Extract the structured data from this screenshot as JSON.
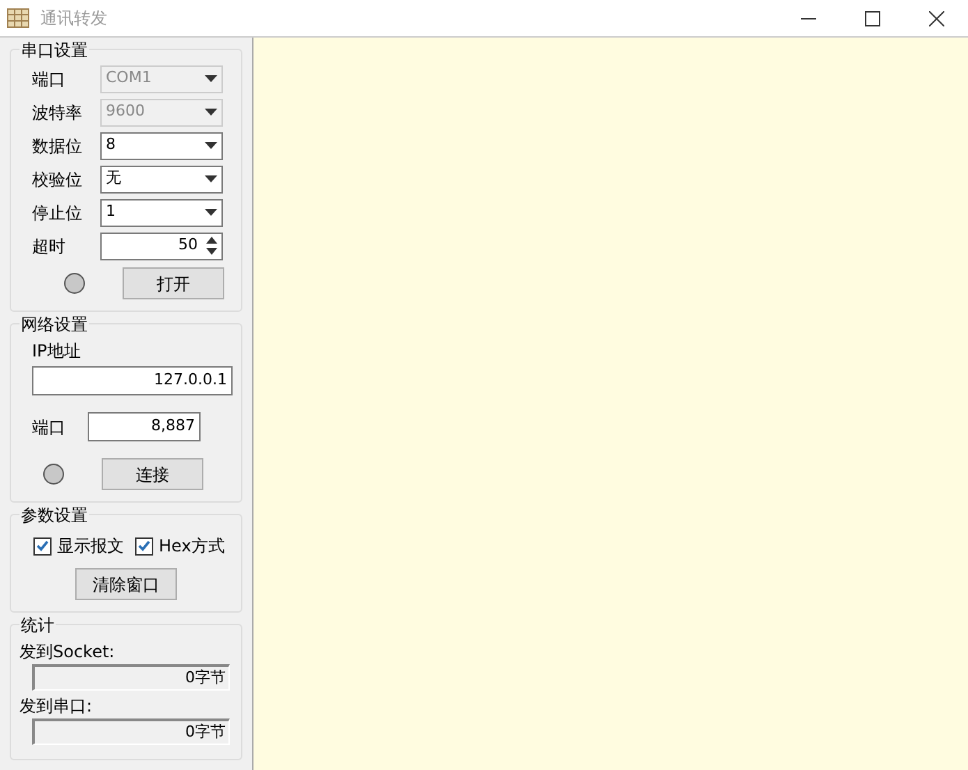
{
  "window": {
    "title": "通讯转发"
  },
  "serial": {
    "title": "串口设置",
    "fields": [
      {
        "label": "端口",
        "kind": "combo",
        "value": "COM1",
        "disabled": true
      },
      {
        "label": "波特率",
        "kind": "combo",
        "value": "9600",
        "disabled": true
      },
      {
        "label": "数据位",
        "kind": "combo",
        "value": "8",
        "disabled": false
      },
      {
        "label": "校验位",
        "kind": "combo",
        "value": "无",
        "disabled": false
      },
      {
        "label": "停止位",
        "kind": "combo",
        "value": "1",
        "disabled": false
      },
      {
        "label": "超时",
        "kind": "spin",
        "value": "50",
        "disabled": false
      }
    ],
    "lit": false,
    "button": "打开"
  },
  "network": {
    "title": "网络设置",
    "ip_label": "IP地址",
    "ip": "127.0.0.1",
    "port_label": "端口",
    "port": "8,887",
    "lit": false,
    "button": "连接"
  },
  "params": {
    "title": "参数设置",
    "options": [
      {
        "label": "显示报文",
        "checked": true
      },
      {
        "label": "Hex方式",
        "checked": true
      }
    ],
    "button": "清除窗口"
  },
  "stats": {
    "title": "统计",
    "items": [
      {
        "label": "发到Socket:",
        "value": "0字节"
      },
      {
        "label": "发到串口:",
        "value": "0字节"
      }
    ]
  }
}
